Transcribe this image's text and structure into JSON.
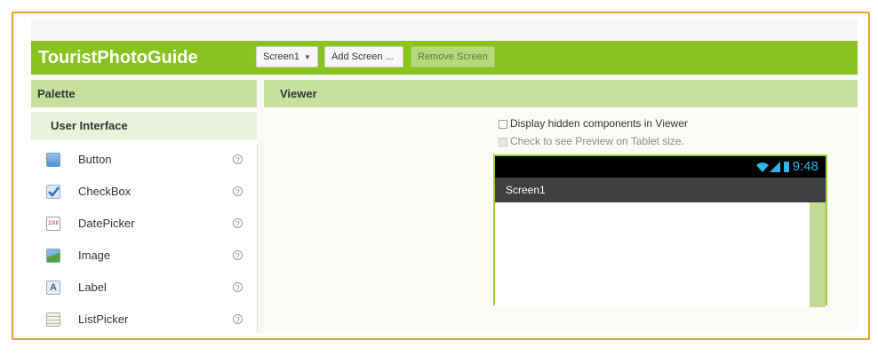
{
  "app": {
    "title": "TouristPhotoGuide"
  },
  "toolbar": {
    "screen_select": "Screen1",
    "add_screen": "Add Screen ...",
    "remove_screen": "Remove Screen"
  },
  "palette": {
    "header": "Palette",
    "section": "User Interface",
    "items": [
      {
        "label": "Button",
        "icon": "button-icon"
      },
      {
        "label": "CheckBox",
        "icon": "checkbox-icon"
      },
      {
        "label": "DatePicker",
        "icon": "datepicker-icon"
      },
      {
        "label": "Image",
        "icon": "image-icon"
      },
      {
        "label": "Label",
        "icon": "label-icon"
      },
      {
        "label": "ListPicker",
        "icon": "listpicker-icon"
      }
    ],
    "help_glyph": "?",
    "datepicker_icon_text": "20III",
    "label_icon_text": "A"
  },
  "viewer": {
    "header": "Viewer",
    "display_hidden": "Display hidden components in Viewer",
    "tablet_preview": "Check to see Preview on Tablet size.",
    "phone": {
      "time": "9:48",
      "screen_title": "Screen1"
    }
  },
  "colors": {
    "accent_green": "#89c320",
    "panel_header": "#c7df9f",
    "frame_orange": "#e3a12f",
    "status_blue": "#33b5e5"
  }
}
